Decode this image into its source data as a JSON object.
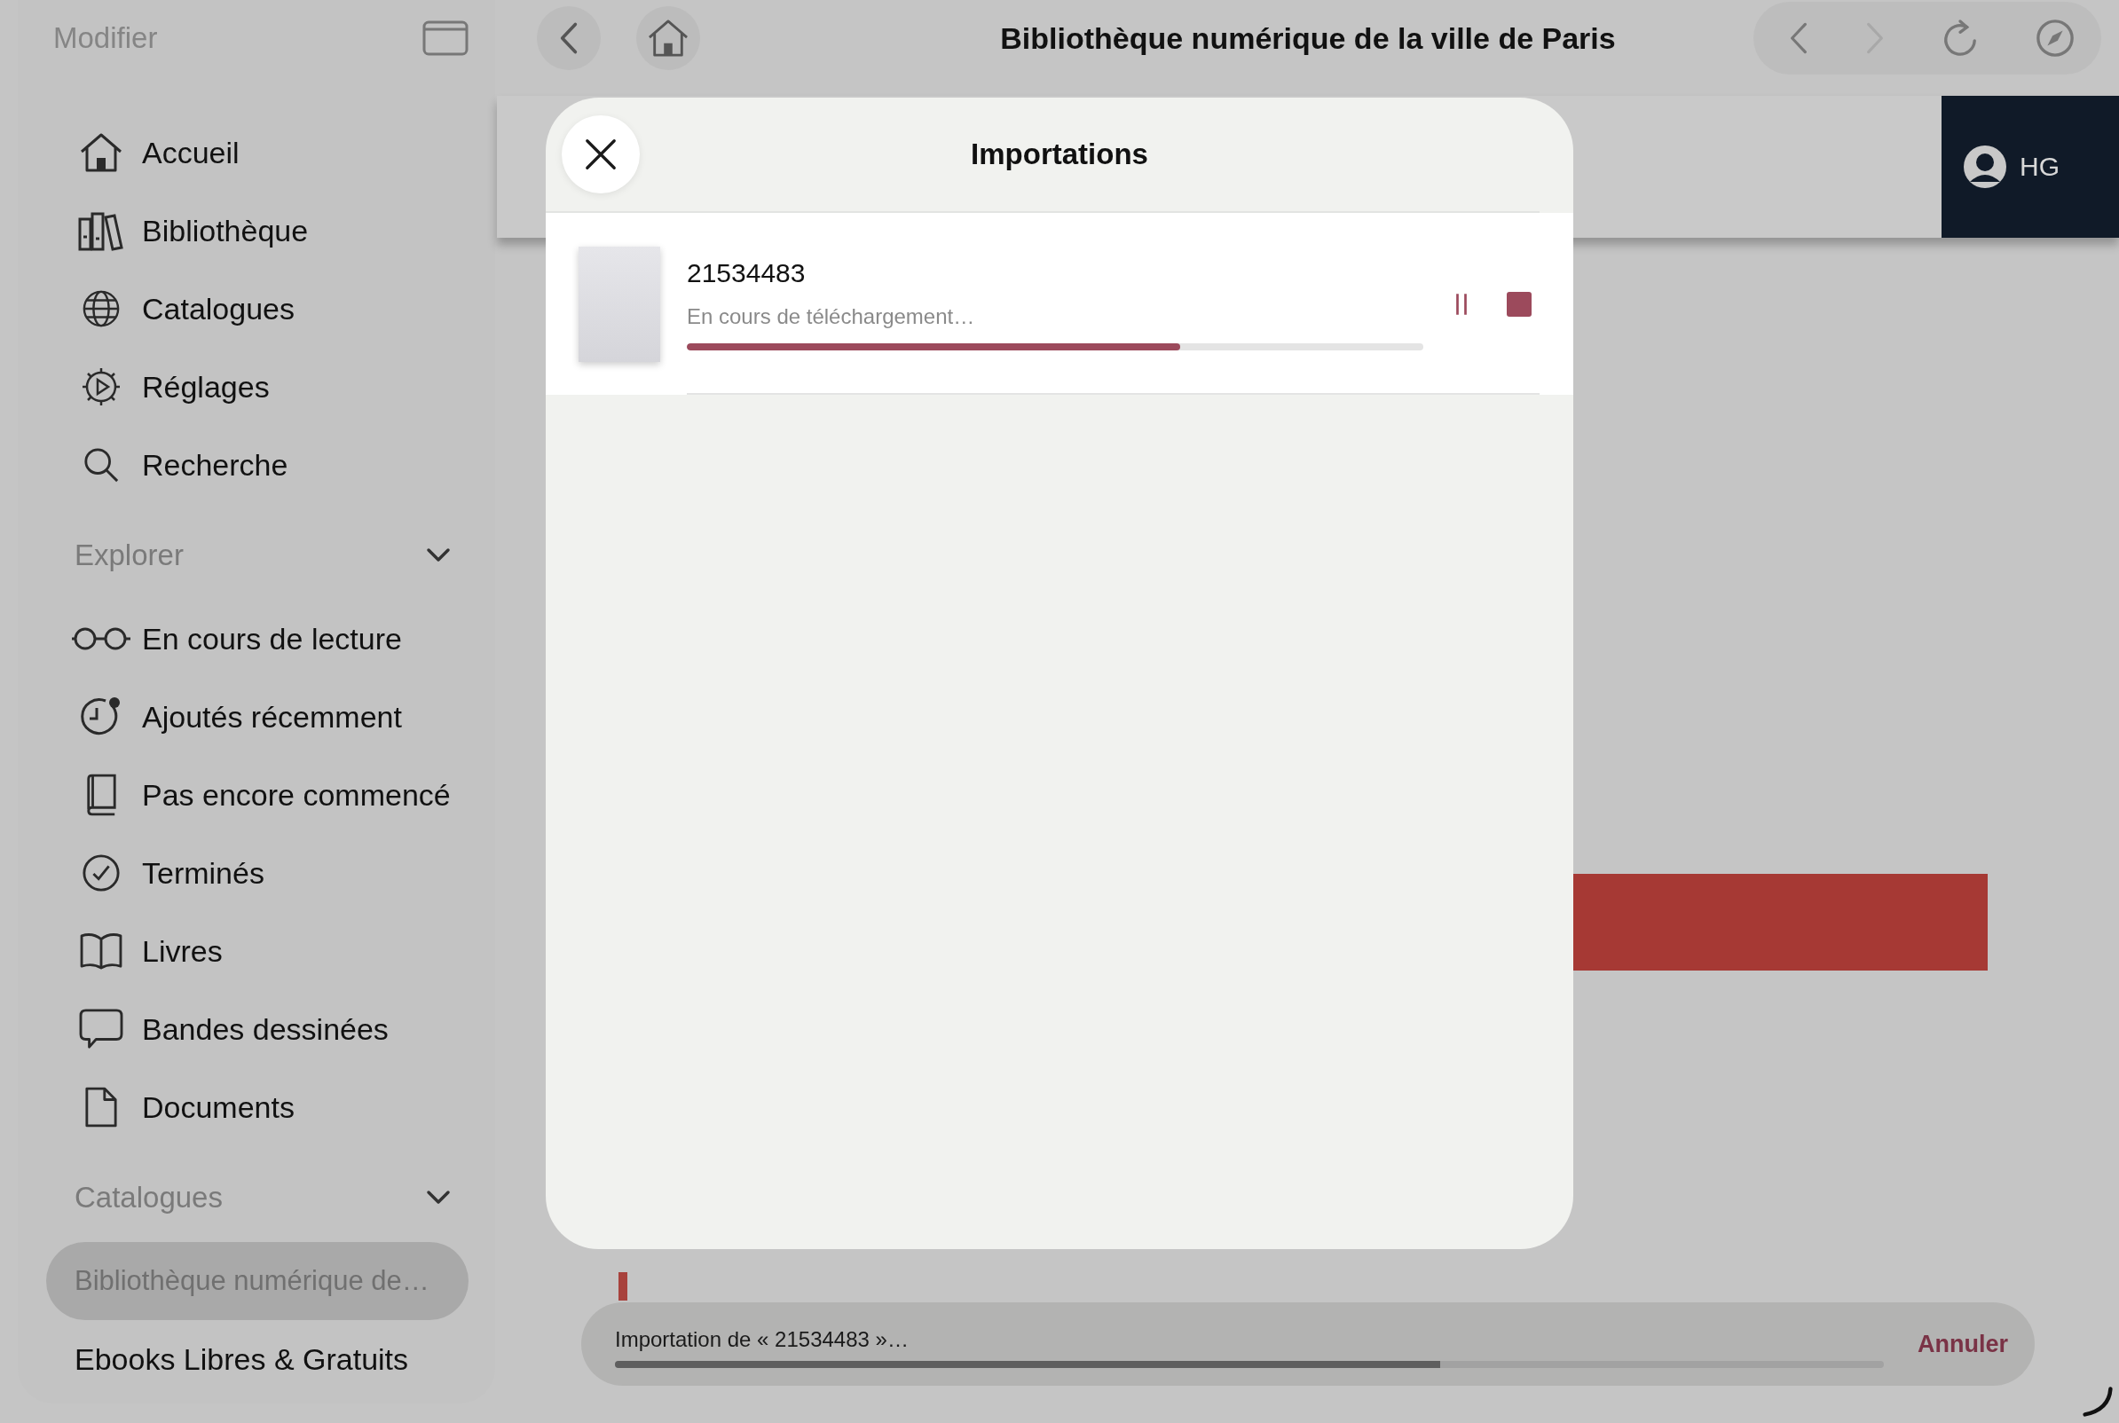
{
  "sidebar": {
    "edit_label": "Modifier",
    "nav": [
      {
        "label": "Accueil"
      },
      {
        "label": "Bibliothèque"
      },
      {
        "label": "Catalogues"
      },
      {
        "label": "Réglages"
      },
      {
        "label": "Recherche"
      }
    ],
    "sections": [
      {
        "title": "Explorer",
        "expanded": true,
        "items": [
          {
            "label": "En cours de lecture",
            "selected": false
          },
          {
            "label": "Ajoutés récemment",
            "selected": false
          },
          {
            "label": "Pas encore commencé",
            "selected": false
          },
          {
            "label": "Terminés",
            "selected": false
          },
          {
            "label": "Livres",
            "selected": false
          },
          {
            "label": "Bandes dessinées",
            "selected": false
          },
          {
            "label": "Documents",
            "selected": false
          }
        ]
      },
      {
        "title": "Catalogues",
        "expanded": true,
        "items": [
          {
            "label": "Bibliothèque numérique de…",
            "selected": true
          },
          {
            "label": "Ebooks Libres & Gratuits",
            "selected": false
          }
        ]
      }
    ]
  },
  "browser": {
    "title": "Bibliothèque numérique de la ville de Paris",
    "nav_buttons": [
      {
        "disabled": false
      },
      {
        "disabled": true
      }
    ]
  },
  "site": {
    "user": "HG"
  },
  "modal": {
    "title": "Importations",
    "items": [
      {
        "name": "21534483",
        "status": "En cours de téléchargement…",
        "level": 0.67,
        "paused": false
      }
    ]
  },
  "toast": {
    "text": "Importation de « 21534483 »…",
    "level": 0.65,
    "action": "Annuler"
  }
}
